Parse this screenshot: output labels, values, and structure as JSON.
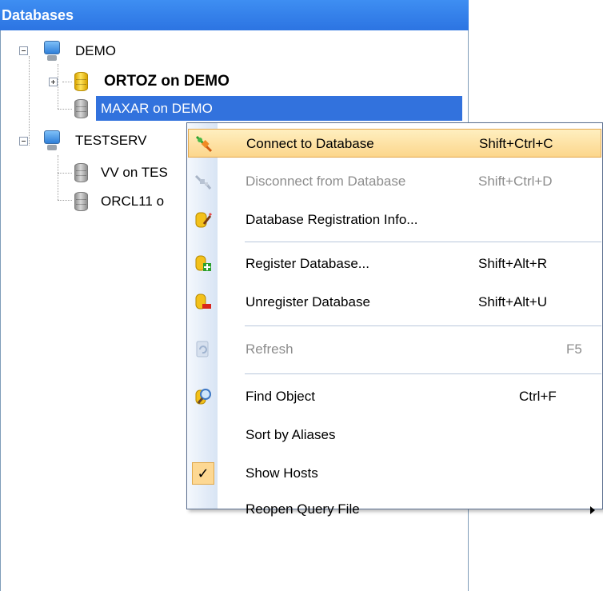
{
  "panel": {
    "title": "Databases"
  },
  "tree": {
    "hosts": [
      {
        "label": "DEMO",
        "databases": [
          {
            "label": "ORTOZ on DEMO",
            "connected": true
          },
          {
            "label": "MAXAR on DEMO",
            "connected": false,
            "selected": true
          }
        ]
      },
      {
        "label": "TESTSERV",
        "databases": [
          {
            "label": "VV on TES",
            "connected": false
          },
          {
            "label": "ORCL11 o",
            "connected": false
          }
        ]
      }
    ]
  },
  "context_menu": {
    "items": [
      {
        "label": "Connect to Database",
        "shortcut": "Shift+Ctrl+C",
        "icon": "connect-plug-icon",
        "state": "highlighted"
      },
      {
        "label": "Disconnect from Database",
        "shortcut": "Shift+Ctrl+D",
        "icon": "disconnect-plug-icon",
        "state": "disabled"
      },
      {
        "label": "Database Registration Info...",
        "shortcut": "",
        "icon": "database-edit-icon",
        "state": "enabled"
      },
      {
        "label": "Register Database...",
        "shortcut": "Shift+Alt+R",
        "icon": "database-add-icon",
        "state": "enabled"
      },
      {
        "label": "Unregister Database",
        "shortcut": "Shift+Alt+U",
        "icon": "database-remove-icon",
        "state": "enabled"
      },
      {
        "label": "Refresh",
        "shortcut": "F5",
        "icon": "refresh-icon",
        "state": "disabled"
      },
      {
        "label": "Find Object",
        "shortcut": "Ctrl+F",
        "icon": "find-object-icon",
        "state": "enabled"
      },
      {
        "label": "Sort by Aliases",
        "shortcut": "",
        "icon": "",
        "state": "enabled"
      },
      {
        "label": "Show Hosts",
        "shortcut": "",
        "icon": "checkmark-icon",
        "state": "checked",
        "check_glyph": "✓"
      },
      {
        "label": "Reopen Query File",
        "shortcut": "",
        "icon": "submenu-arrow-icon",
        "state": "enabled"
      }
    ]
  },
  "colors": {
    "header": "#2c74e2",
    "selection": "#3272dd",
    "menu_highlight": "#fcd68c",
    "disabled_text": "#8d8d8d"
  }
}
